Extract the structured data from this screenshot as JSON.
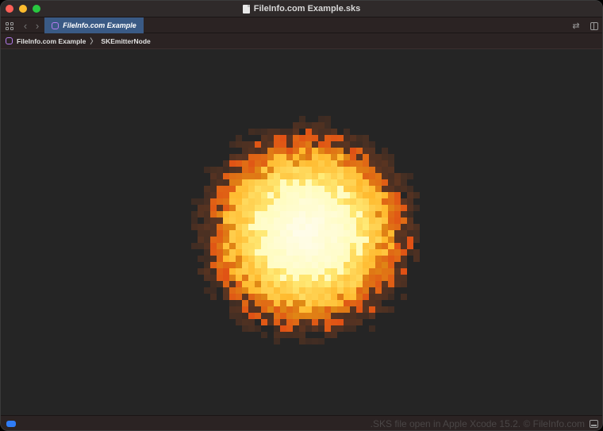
{
  "window": {
    "title": "FileInfo.com Example.sks"
  },
  "tabbar": {
    "active_tab": "FileInfo.com Example"
  },
  "breadcrumb": {
    "items": [
      "FileInfo.com Example",
      "SKEmitterNode"
    ],
    "separator": "〉"
  },
  "status": {
    "text": ".SKS file open in Apple Xcode 15.2. © FileInfo.com"
  },
  "icons": {
    "document": "document-icon",
    "grid": "grid-icon",
    "back": "chevron-left-icon",
    "forward": "chevron-right-icon",
    "sks": "particle-file-icon",
    "swap": "swap-icon",
    "split": "split-editor-icon",
    "panel": "debug-area-icon"
  },
  "colors": {
    "accent_tab": "#3a5a85",
    "particle_icon": "#b57cf0",
    "status_pill": "#2f7cf6"
  }
}
